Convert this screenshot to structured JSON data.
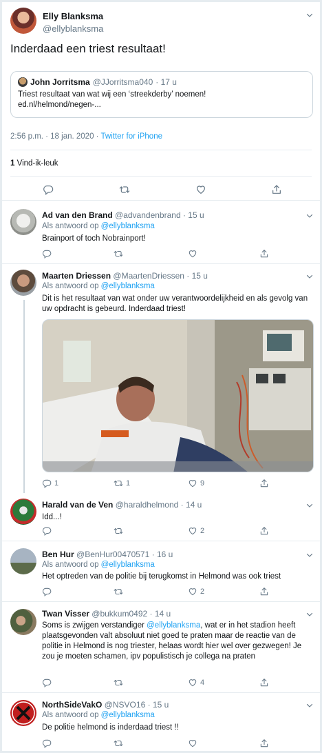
{
  "main_tweet": {
    "author_name": "Elly Blanksma",
    "author_handle": "@ellyblanksma",
    "text": "Inderdaad een triest resultaat!",
    "quote": {
      "author_name": "John Jorritsma",
      "author_handle": "@JJorritsma040",
      "time": "· 17 u",
      "text": "Triest resultaat van wat wij een ‘streekderby’ noemen!",
      "link": "ed.nl/helmond/negen-..."
    },
    "timestamp": "2:56 p.m. · 18 jan. 2020 ·",
    "source": "Twitter for iPhone",
    "like_count": "1",
    "like_label": "Vind-ik-leuk"
  },
  "replies": [
    {
      "name": "Ad van den Brand",
      "handle": "@advandenbrand",
      "time": "· 15 u",
      "reply_prefix": "Als antwoord op",
      "reply_to": "@ellyblanksma",
      "text": "Brainport of toch Nobrainport!",
      "reply_count": "",
      "retweet_count": "",
      "like_count": ""
    },
    {
      "name": "Maarten Driessen",
      "handle": "@MaartenDriessen",
      "time": "· 15 u",
      "reply_prefix": "Als antwoord op",
      "reply_to": "@ellyblanksma",
      "text": "Dit is het resultaat van wat onder uw verantwoordelijkheid en als gevolg van uw opdracht is gebeurd. Inderdaad triest!",
      "reply_count": "1",
      "retweet_count": "1",
      "like_count": "9"
    },
    {
      "name": "Harald van de Ven",
      "handle": "@haraldhelmond",
      "time": "· 14 u",
      "text": "Idd...!",
      "reply_count": "",
      "retweet_count": "",
      "like_count": "2"
    },
    {
      "name": "Ben Hur",
      "handle": "@BenHur00470571",
      "time": "· 16 u",
      "reply_prefix": "Als antwoord op",
      "reply_to": "@ellyblanksma",
      "text": "Het optreden van de politie bij terugkomst in Helmond was ook triest",
      "reply_count": "",
      "retweet_count": "",
      "like_count": "2"
    },
    {
      "name": "Twan Visser",
      "handle": "@bukkum0492",
      "time": "· 14 u",
      "text_before": "Soms is zwijgen verstandiger ",
      "text_mention": "@ellyblanksma",
      "text_after": ", wat er in het stadion heeft plaatsgevonden valt absoluut niet goed te praten maar de reactie van de politie in Helmond is nog triester, helaas wordt hier wel over gezwegen! Je zou je moeten schamen, ipv populistisch je collega na praten",
      "reply_count": "",
      "retweet_count": "",
      "like_count": "4"
    },
    {
      "name": "NorthSideVakO",
      "handle": "@NSVO16",
      "time": "· 15 u",
      "reply_prefix": "Als antwoord op",
      "reply_to": "@ellyblanksma",
      "text": "De politie helmond is inderdaad triest !!",
      "reply_count": "",
      "retweet_count": "",
      "like_count": ""
    }
  ],
  "colors": {
    "accent": "#1da1f2",
    "secondary_text": "#657786",
    "border": "#e6ecf0"
  },
  "icons": [
    "chevron-down-icon",
    "reply-icon",
    "retweet-icon",
    "like-icon",
    "share-icon"
  ]
}
